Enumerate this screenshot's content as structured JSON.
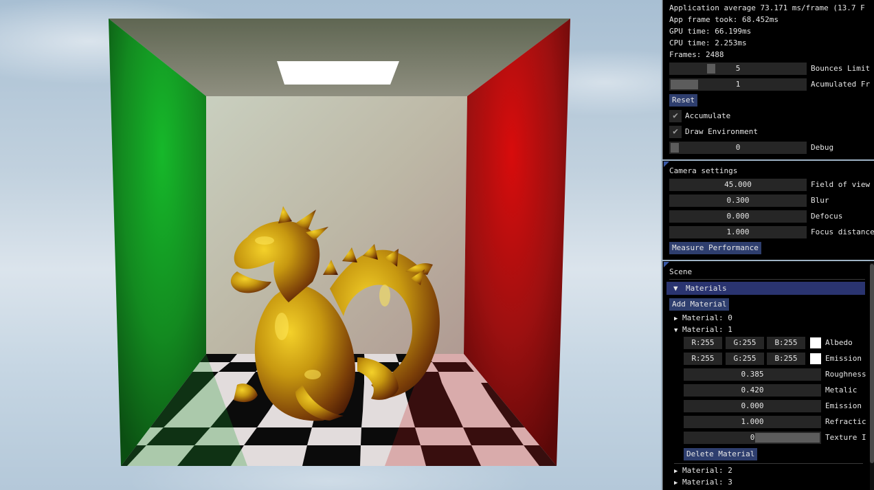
{
  "stats": {
    "app_average": "Application average 73.171 ms/frame (13.7 F",
    "app_frame": "App frame took: 68.452ms",
    "gpu_time": "GPU time: 66.199ms",
    "cpu_time": "CPU time: 2.253ms",
    "frames": "Frames: 2488"
  },
  "renderer": {
    "bounces_value": "5",
    "bounces_label": "Bounces Limit",
    "accum_value": "1",
    "accum_label": "Acumulated Fr",
    "reset_label": "Reset",
    "accumulate_label": "Accumulate",
    "accumulate_checked": true,
    "draw_env_label": "Draw Environment",
    "draw_env_checked": true,
    "debug_value": "0",
    "debug_label": "Debug",
    "check_glyph": "✔"
  },
  "camera": {
    "title": "Camera settings",
    "fov_value": "45.000",
    "fov_label": "Field of view",
    "blur_value": "0.300",
    "blur_label": "Blur",
    "defocus_value": "0.000",
    "defocus_label": "Defocus",
    "focus_value": "1.000",
    "focus_label": "Focus distance",
    "measure_label": "Measure Performance"
  },
  "scene": {
    "title": "Scene",
    "materials_header": "Materials",
    "open_glyph": "▼",
    "arrow_closed": "▶",
    "arrow_open": "▼",
    "add_material": "Add Material",
    "material0": "Material: 0",
    "material1": "Material: 1",
    "albedo": {
      "r": "R:255",
      "g": "G:255",
      "b": "B:255",
      "label": "Albedo",
      "color": "#ffffff"
    },
    "emission_color": {
      "r": "R:255",
      "g": "G:255",
      "b": "B:255",
      "label": "Emission",
      "color": "#ffffff"
    },
    "roughness_value": "0.385",
    "roughness_label": "Roughness",
    "metalic_value": "0.420",
    "metalic_label": "Metalic",
    "emission_value": "0.000",
    "emission_label": "Emission",
    "refraction_value": "1.000",
    "refraction_label": "Refractic",
    "texture_value": "0",
    "texture_label": "Texture I",
    "delete_material": "Delete Material",
    "material2": "Material: 2",
    "material3": "Material: 3"
  },
  "colors": {
    "panel_bg": "#000000",
    "frame_bg": "#262626",
    "button": "#2e3e6e",
    "header": "#2a3470",
    "wall_left": "#1f8a28",
    "wall_right": "#a01414",
    "dragon": "#b08a10"
  }
}
